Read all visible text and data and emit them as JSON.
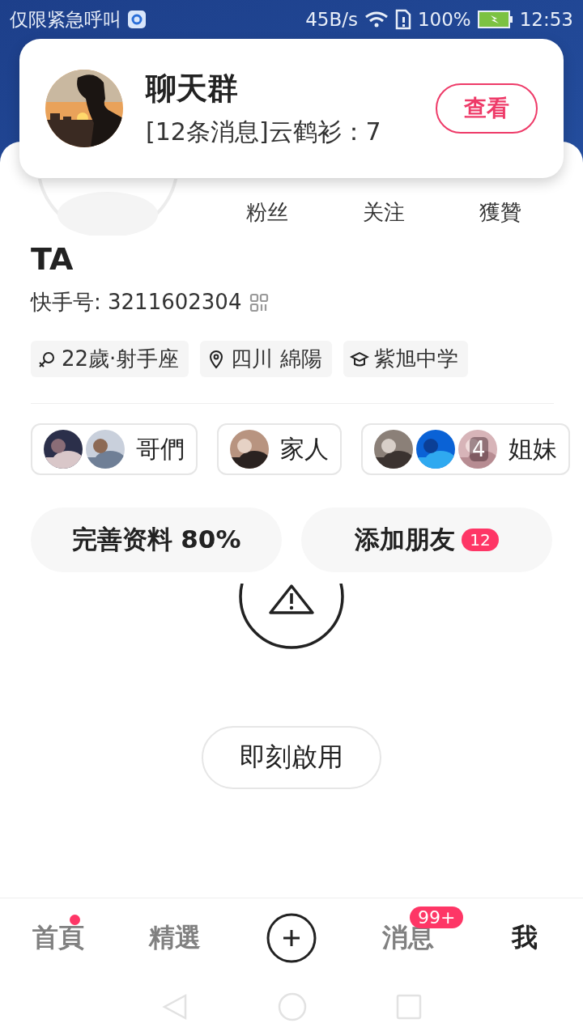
{
  "status_bar": {
    "carrier": "仅限紧急呼叫",
    "speed": "45B/s",
    "battery": "100%",
    "time": "12:53"
  },
  "notification": {
    "title": "聊天群",
    "message": "[12条消息]云鹤衫：7",
    "action": "查看"
  },
  "stats": [
    {
      "label": "粉丝"
    },
    {
      "label": "关注"
    },
    {
      "label": "獲贊"
    }
  ],
  "profile": {
    "name": "TA",
    "id_label": "快手号: 3211602304"
  },
  "tags": [
    {
      "kind": "gender",
      "label": "22歲·射手座"
    },
    {
      "kind": "location",
      "label": "四川 綿陽"
    },
    {
      "kind": "school",
      "label": "紫旭中学"
    }
  ],
  "groups": [
    {
      "label": "哥們",
      "avatars": [
        {
          "kind": "picture"
        },
        {
          "kind": "picture"
        }
      ]
    },
    {
      "label": "家人",
      "avatars": [
        {
          "kind": "picture"
        }
      ]
    },
    {
      "label": "姐妹",
      "avatars": [
        {
          "kind": "picture"
        },
        {
          "kind": "picture"
        },
        {
          "kind": "picture",
          "count": "4"
        }
      ]
    }
  ],
  "actions": [
    {
      "label": "完善资料 80%"
    },
    {
      "label": "添加朋友",
      "badge": "12"
    }
  ],
  "enable_button": "即刻啟用",
  "tabs": [
    {
      "kind": "text",
      "label": "首頁",
      "selected": false,
      "dot": true
    },
    {
      "kind": "text",
      "label": "精選",
      "selected": false,
      "dot": false
    },
    {
      "kind": "plus",
      "selected": false
    },
    {
      "kind": "text",
      "label": "消息",
      "selected": false,
      "dot": false,
      "badge": "99+"
    },
    {
      "kind": "text",
      "label": "我",
      "selected": true,
      "dot": false
    }
  ]
}
